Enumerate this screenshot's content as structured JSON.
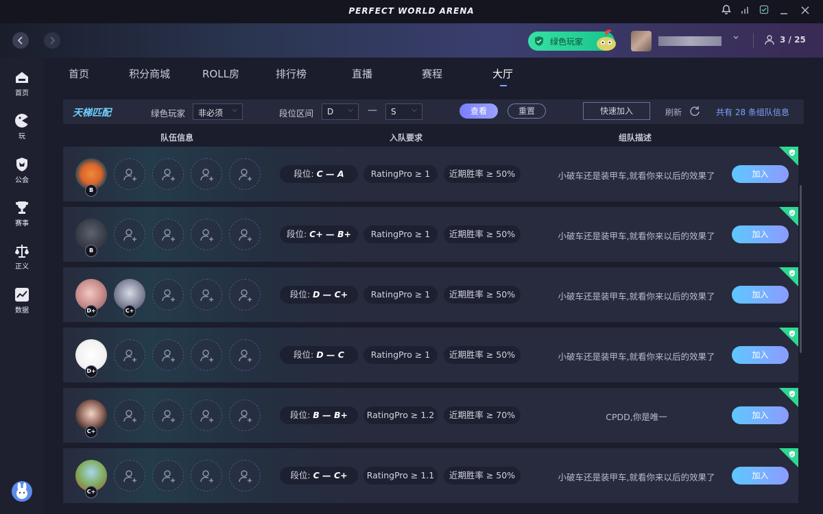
{
  "app": {
    "title": "PERFECT WORLD ARENA"
  },
  "header": {
    "badge_label": "绿色玩家",
    "party_count": "3 / 25"
  },
  "sidebar": {
    "items": [
      {
        "label": "首页",
        "icon": "home-icon"
      },
      {
        "label": "玩",
        "icon": "gamepad-icon"
      },
      {
        "label": "公会",
        "icon": "guild-icon"
      },
      {
        "label": "赛事",
        "icon": "trophy-icon"
      },
      {
        "label": "正义",
        "icon": "justice-icon"
      },
      {
        "label": "数据",
        "icon": "chart-icon"
      }
    ]
  },
  "tabs": [
    {
      "label": "首页"
    },
    {
      "label": "积分商城"
    },
    {
      "label": "ROLL房"
    },
    {
      "label": "排行榜"
    },
    {
      "label": "直播"
    },
    {
      "label": "赛程"
    },
    {
      "label": "大厅",
      "active": true
    }
  ],
  "filter": {
    "title": "天梯匹配",
    "green_label": "绿色玩家",
    "green_value": "非必须",
    "rank_label": "段位区间",
    "rank_from": "D",
    "rank_to": "S",
    "dash": "—",
    "view_label": "查看",
    "reset_label": "重置",
    "quick_join_label": "快速加入",
    "refresh_label": "刷新",
    "total_text": "共有 28 条组队信息"
  },
  "columns": {
    "team": "队伍信息",
    "requirement": "入队要求",
    "description": "组队描述"
  },
  "rank_prefix": "段位:",
  "rows": [
    {
      "members": [
        "B"
      ],
      "rank": "C — A",
      "rating": "RatingPro ≥ 1",
      "winrate": "近期胜率 ≥ 50%",
      "desc": "小破车还是装甲车,就看你来以后的效果了",
      "join": "加入"
    },
    {
      "members": [
        "B"
      ],
      "rank": "C+ — B+",
      "rating": "RatingPro ≥ 1",
      "winrate": "近期胜率 ≥ 50%",
      "desc": "小破车还是装甲车,就看你来以后的效果了",
      "join": "加入"
    },
    {
      "members": [
        "D+",
        "C+"
      ],
      "rank": "D — C+",
      "rating": "RatingPro ≥ 1",
      "winrate": "近期胜率 ≥ 50%",
      "desc": "小破车还是装甲车,就看你来以后的效果了",
      "join": "加入"
    },
    {
      "members": [
        "D+"
      ],
      "rank": "D — C",
      "rating": "RatingPro ≥ 1",
      "winrate": "近期胜率 ≥ 50%",
      "desc": "小破车还是装甲车,就看你来以后的效果了",
      "join": "加入"
    },
    {
      "members": [
        "C+"
      ],
      "rank": "B — B+",
      "rating": "RatingPro ≥ 1.2",
      "winrate": "近期胜率 ≥ 70%",
      "desc": "CPDD,你是唯一",
      "join": "加入"
    },
    {
      "members": [
        "C+"
      ],
      "rank": "C — C+",
      "rating": "RatingPro ≥ 1.1",
      "winrate": "近期胜率 ≥ 50%",
      "desc": "小破车还是装甲车,就看你来以后的效果了",
      "join": "加入"
    }
  ],
  "colors": {
    "accent": "#7fa2ff",
    "green": "#2fd792",
    "join_gradient_start": "#5ec7ff",
    "join_gradient_end": "#8c9bff"
  }
}
